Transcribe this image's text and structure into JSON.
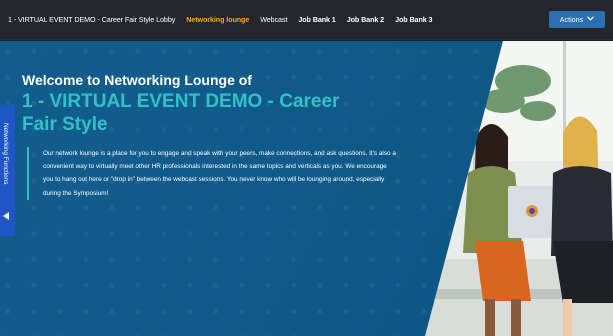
{
  "nav": {
    "items": [
      {
        "label": "1 - VIRTUAL EVENT DEMO - Career Fair Style Lobby",
        "state": "normal"
      },
      {
        "label": "Networking lounge",
        "state": "active"
      },
      {
        "label": "Webcast",
        "state": "normal"
      },
      {
        "label": "Job Bank 1",
        "state": "bold"
      },
      {
        "label": "Job Bank 2",
        "state": "bold"
      },
      {
        "label": "Job Bank 3",
        "state": "bold"
      }
    ],
    "actions_label": "Actions",
    "actions_icon": "chevron-down-icon"
  },
  "hero": {
    "welcome": "Welcome to Networking Lounge of",
    "headline": "1 - VIRTUAL EVENT DEMO - Career Fair Style",
    "body": "Our network lounge is a place for you to engage and speak with your peers, make connections, and ask questions. It's also a convenient way to virtually meet other HR professionals interested in the same topics and verticals as you. We encourage you to hang out here or \"drop in\" between the webcast sessions. You never know who will be lounging around, especially during the Symposium!"
  },
  "side_tab": {
    "label": "Networking Functions",
    "icon": "triangle-left-icon"
  },
  "colors": {
    "topbar_bg": "#23262a",
    "active_nav": "#f5a623",
    "actions_button": "#2b6fb0",
    "panel_blue": "#0f5a87",
    "headline_teal": "#33c1c8",
    "side_tab": "#1f56c6"
  }
}
